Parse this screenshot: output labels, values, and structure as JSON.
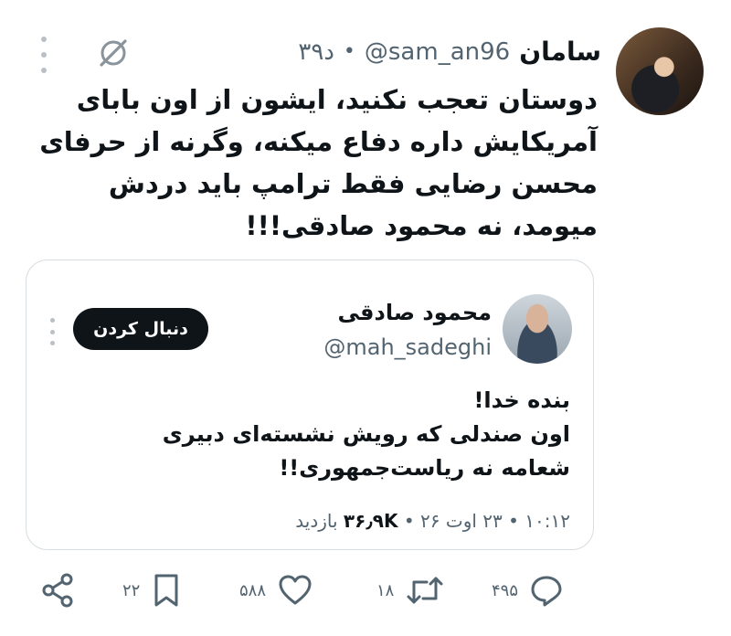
{
  "tweet": {
    "author_name": "سامان",
    "author_handle": "@sam_an96",
    "time": "۳۹د",
    "separator": "•",
    "text": "دوستان تعجب نکنید، ایشون از اون بابای آمریکایش داره دفاع میکنه، وگرنه از حرفای محسن رضایی فقط ترامپ باید دردش میومد، نه محمود صادقی!!!"
  },
  "quote": {
    "author_name": "محمود صادقی",
    "author_handle": "@mah_sadeghi",
    "follow_label": "دنبال کردن",
    "text_line1": "بنده خدا!",
    "text_line2": "اون صندلی که رویش نشسته‌ای دبیری شعامه نه ریاست‌جمهوری!!",
    "time": "۱۰:۱۲",
    "date": "۲۳ اوت ۲۶",
    "views_count": "۳۶٫۹K",
    "views_label": "بازدید",
    "separator": "•"
  },
  "actions": {
    "replies": "۴۹۵",
    "retweets": "۱۸",
    "likes": "۵۸۸",
    "bookmarks": "۲۲"
  },
  "icons": {
    "more": "more-vertical-icon",
    "grok": "grok-icon",
    "reply": "reply-icon",
    "retweet": "retweet-icon",
    "like": "heart-icon",
    "bookmark": "bookmark-icon",
    "share": "share-icon"
  },
  "colors": {
    "text": "#0f1419",
    "secondary": "#536471",
    "follow_bg": "#0f1419",
    "border": "#d7dde1"
  }
}
